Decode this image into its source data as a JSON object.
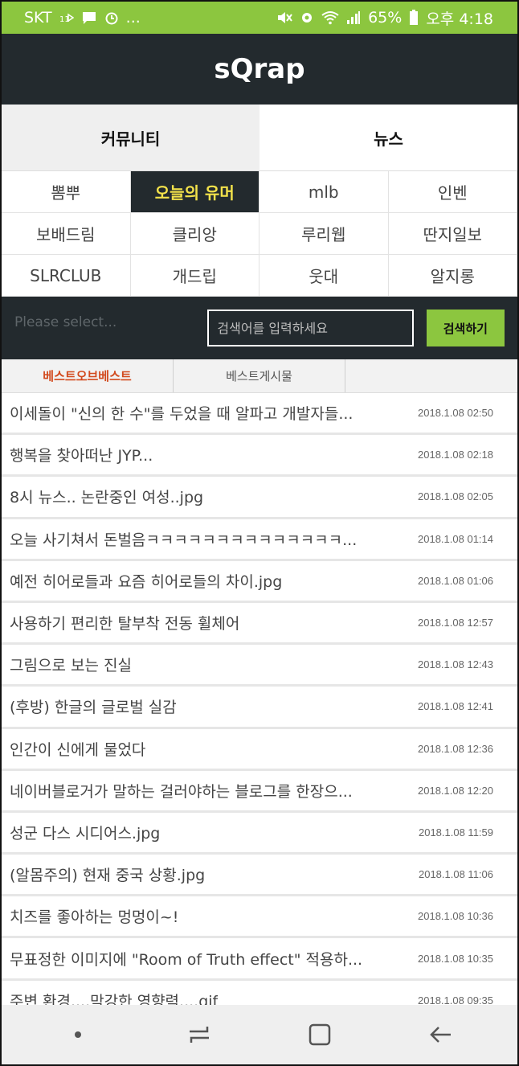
{
  "status_bar": {
    "carrier": "SKT",
    "left_extra": "...",
    "battery": "65%",
    "time": "오후 4:18",
    "bg_color": "#8cc63f"
  },
  "app": {
    "title": "sQrap",
    "header_color": "#232a2e"
  },
  "main_tabs": [
    {
      "label": "커뮤니티",
      "active": true
    },
    {
      "label": "뉴스",
      "active": false
    }
  ],
  "sites": [
    {
      "label": "뽐뿌"
    },
    {
      "label": "오늘의 유머",
      "selected": true
    },
    {
      "label": "mlb"
    },
    {
      "label": "인벤"
    },
    {
      "label": "보배드림"
    },
    {
      "label": "클리앙"
    },
    {
      "label": "루리웹"
    },
    {
      "label": "딴지일보"
    },
    {
      "label": "SLRCLUB"
    },
    {
      "label": "개드립"
    },
    {
      "label": "웃대"
    },
    {
      "label": "알지롱"
    }
  ],
  "search": {
    "select_placeholder": "Please select...",
    "input_placeholder": "검색어를 입력하세요",
    "button_label": "검색하기",
    "button_color": "#8cc63f"
  },
  "sub_tabs": [
    {
      "label": "베스트오브베스트",
      "active": true
    },
    {
      "label": "베스트게시물",
      "active": false
    }
  ],
  "posts": [
    {
      "title": "이세돌이 \"신의 한 수\"를 두었을 때 알파고 개발자들...",
      "time": "2018.1.08 02:50"
    },
    {
      "title": "행복을 찾아떠난 JYP...",
      "time": "2018.1.08 02:18"
    },
    {
      "title": "8시 뉴스.. 논란중인 여성..jpg",
      "time": "2018.1.08 02:05"
    },
    {
      "title": "오늘 사기쳐서 돈벌음ㅋㅋㅋㅋㅋㅋㅋㅋㅋㅋㅋㅋㅋㅋ...",
      "time": "2018.1.08 01:14"
    },
    {
      "title": "예전 히어로들과 요즘 히어로들의 차이.jpg",
      "time": "2018.1.08 01:06"
    },
    {
      "title": "사용하기 편리한 탈부착 전동 휠체어",
      "time": "2018.1.08 12:57"
    },
    {
      "title": "그림으로 보는 진실",
      "time": "2018.1.08 12:43"
    },
    {
      "title": "(후방) 한글의 글로벌 실감",
      "time": "2018.1.08 12:41"
    },
    {
      "title": "인간이 신에게 물었다",
      "time": "2018.1.08 12:36"
    },
    {
      "title": "네이버블로거가 말하는 걸러야하는 블로그를 한장으...",
      "time": "2018.1.08 12:20"
    },
    {
      "title": "성군 다스 시디어스.jpg",
      "time": "2018.1.08 11:59"
    },
    {
      "title": "(알몸주의) 현재 중국 상황.jpg",
      "time": "2018.1.08 11:06"
    },
    {
      "title": "치즈를 좋아하는 멍멍이~!",
      "time": "2018.1.08 10:36"
    },
    {
      "title": "무표정한 이미지에 \"Room of Truth effect\" 적용하...",
      "time": "2018.1.08 10:35"
    },
    {
      "title": "주변 환경....막강한 영향력....gif",
      "time": "2018.1.08 09:35"
    }
  ],
  "icons": {
    "status_left": [
      "lte-icon",
      "message-icon",
      "alarm-icon"
    ],
    "status_right": [
      "mute-icon",
      "settings-icon",
      "wifi-icon",
      "signal-icon",
      "battery-icon"
    ],
    "nav": [
      "dot-icon",
      "recent-apps-icon",
      "home-icon",
      "back-icon"
    ]
  }
}
